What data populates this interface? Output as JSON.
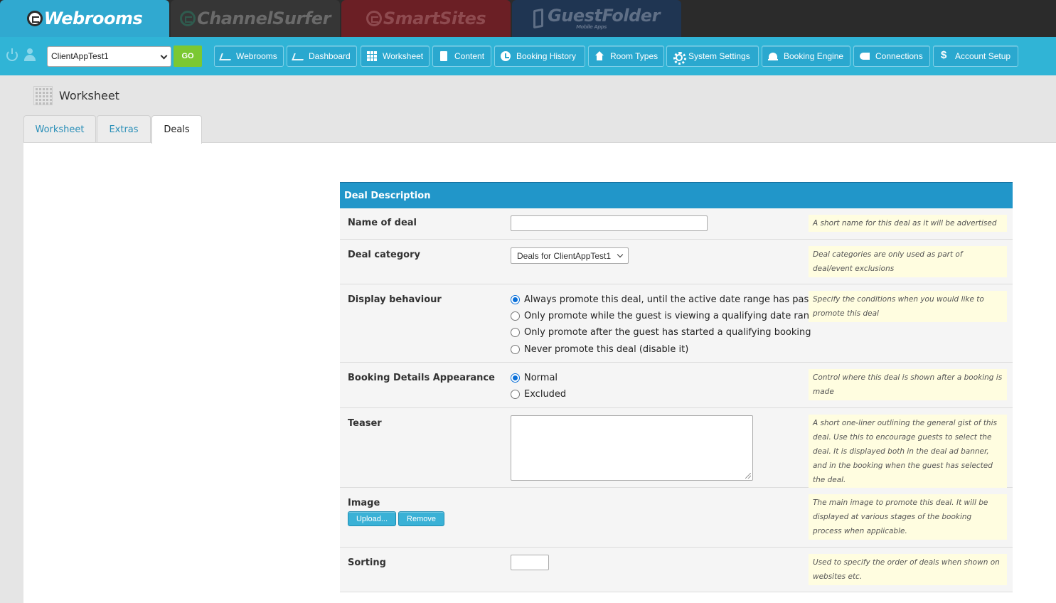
{
  "brands": {
    "webrooms": "Webrooms",
    "channelsurfer": "ChannelSurfer",
    "smartsites": "SmartSites",
    "guestfolder": "GuestFolder",
    "guestfolder_sub": "Mobile Apps"
  },
  "nav": {
    "client_select": "ClientAppTest1",
    "go": "GO",
    "buttons": {
      "webrooms": "Webrooms",
      "dashboard": "Dashboard",
      "worksheet": "Worksheet",
      "content": "Content",
      "booking_history": "Booking History",
      "room_types": "Room Types",
      "system_settings": "System Settings",
      "booking_engine": "Booking Engine",
      "connections": "Connections",
      "account_setup": "Account Setup"
    }
  },
  "page": {
    "title": "Worksheet"
  },
  "tabs": {
    "worksheet": "Worksheet",
    "extras": "Extras",
    "deals": "Deals"
  },
  "form": {
    "header": "Deal Description",
    "name": {
      "label": "Name of deal",
      "value": "",
      "hint": "A short name for this deal as it will be advertised"
    },
    "category": {
      "label": "Deal category",
      "selected": "Deals for ClientAppTest1",
      "hint": "Deal categories are only used as part of deal/event exclusions"
    },
    "display": {
      "label": "Display behaviour",
      "options": [
        "Always promote this deal, until the active date range has passed",
        "Only promote while the guest is viewing a qualifying date range",
        "Only promote after the guest has started a qualifying booking",
        "Never promote this deal (disable it)"
      ],
      "selected_index": 0,
      "hint": "Specify the conditions when you would like to promote this deal"
    },
    "booking": {
      "label": "Booking Details Appearance",
      "options": [
        "Normal",
        "Excluded"
      ],
      "selected_index": 0,
      "hint": "Control where this deal is shown after a booking is made"
    },
    "teaser": {
      "label": "Teaser",
      "value": "",
      "hint": "A short one-liner outlining the general gist of this deal. Use this to encourage guests to select the deal. It is displayed both in the deal ad banner, and in the booking when the guest has selected the deal."
    },
    "image": {
      "label": "Image",
      "upload": "Upload...",
      "remove": "Remove",
      "hint": "The main image to promote this deal. It will be displayed at various stages of the booking process when applicable."
    },
    "sorting": {
      "label": "Sorting",
      "value": "",
      "hint": "Used to specify the order of deals when shown on websites etc."
    }
  }
}
